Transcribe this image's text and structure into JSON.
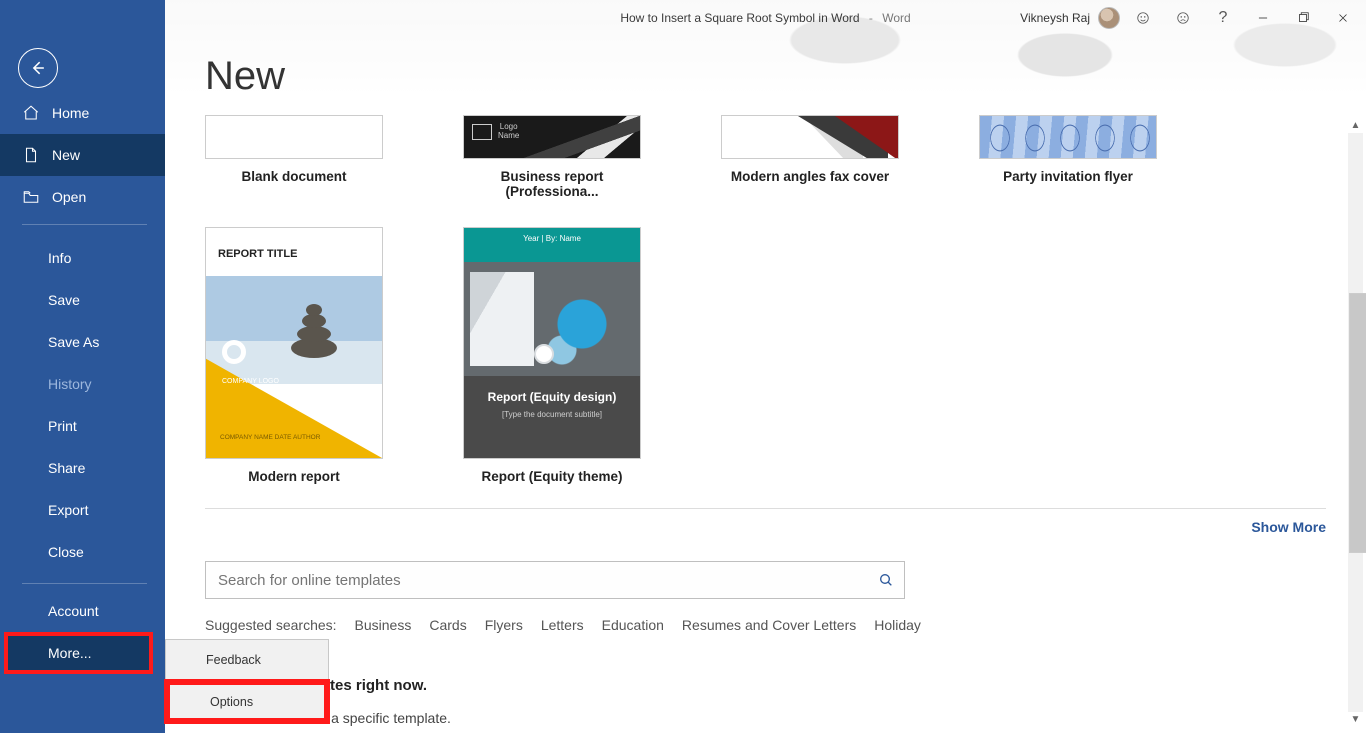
{
  "titlebar": {
    "doc_title": "How to Insert a Square Root Symbol in Word",
    "app_name": "Word",
    "user_name": "Vikneysh Raj"
  },
  "sidebar": {
    "back": "Back",
    "home": "Home",
    "new": "New",
    "open": "Open",
    "info": "Info",
    "save": "Save",
    "save_as": "Save As",
    "history": "History",
    "print": "Print",
    "share": "Share",
    "export": "Export",
    "close": "Close",
    "account": "Account",
    "more": "More..."
  },
  "flyout": {
    "feedback": "Feedback",
    "options": "Options"
  },
  "page": {
    "title": "New",
    "show_more": "Show More",
    "search_placeholder": "Search for online templates",
    "suggested_label": "Suggested searches:",
    "suggested": [
      "Business",
      "Cards",
      "Flyers",
      "Letters",
      "Education",
      "Resumes and Cover Letters",
      "Holiday"
    ],
    "cant_find_heading": "any Office templates right now.",
    "cant_find_body": "e search box to find a specific template."
  },
  "templates": {
    "row1": [
      {
        "label": "Blank document"
      },
      {
        "label": "Business report (Professiona..."
      },
      {
        "label": "Modern angles fax cover"
      },
      {
        "label": "Party invitation flyer"
      }
    ],
    "row2": [
      {
        "label": "Modern report",
        "title": "REPORT TITLE",
        "company": "COMPANY\nLOGO",
        "meta": "COMPANY NAME\nDATE\nAUTHOR"
      },
      {
        "label": "Report (Equity theme)",
        "bar": "Year | By: Name",
        "title": "Report (Equity design)",
        "sub": "[Type the document subtitle]"
      }
    ]
  }
}
